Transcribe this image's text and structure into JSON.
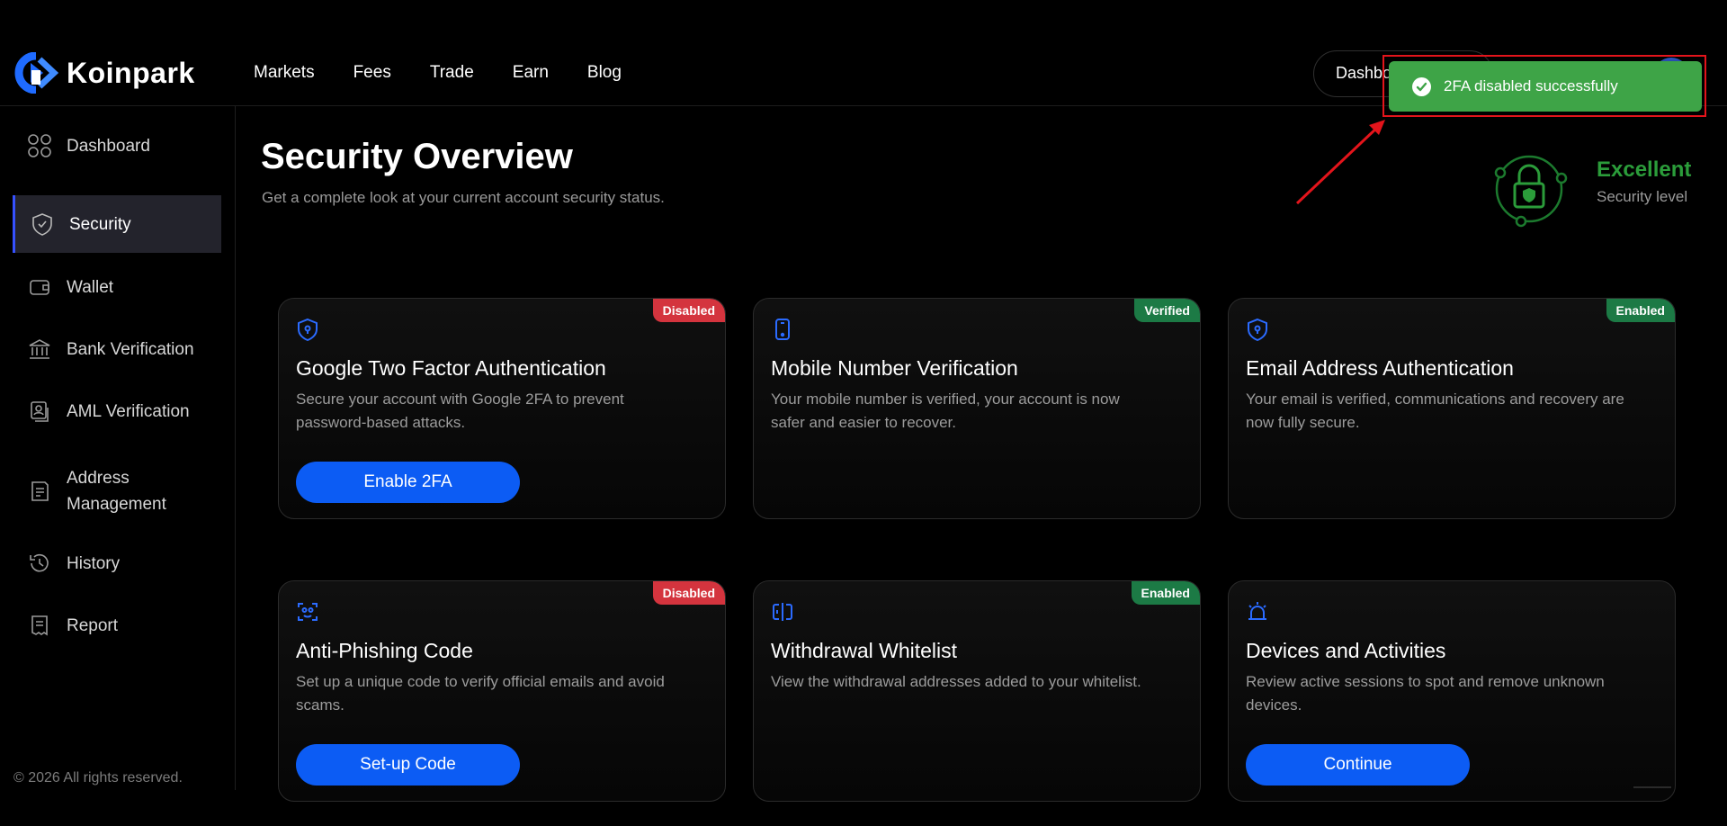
{
  "brand": {
    "name": "Koinpark",
    "accent": "#3651ff"
  },
  "nav": [
    {
      "label": "Markets"
    },
    {
      "label": "Fees"
    },
    {
      "label": "Trade"
    },
    {
      "label": "Earn"
    },
    {
      "label": "Blog"
    }
  ],
  "header_right": {
    "dashboard_label": "Dashbo"
  },
  "toast": {
    "message": "2FA disabled successfully",
    "color": "#3ea447",
    "icon": "check-circle-icon"
  },
  "sidebar": {
    "items": [
      {
        "label": "Dashboard",
        "icon": "grid-icon"
      },
      {
        "label": "Security",
        "icon": "shield-check-icon"
      },
      {
        "label": "Wallet",
        "icon": "wallet-icon"
      },
      {
        "label": "Bank Verification",
        "icon": "bank-icon"
      },
      {
        "label": "AML Verification",
        "icon": "id-card-icon"
      },
      {
        "label": "Address Management",
        "icon": "address-book-icon"
      },
      {
        "label": "History",
        "icon": "history-icon"
      },
      {
        "label": "Report",
        "icon": "report-icon"
      }
    ],
    "active": "Security",
    "copyright": "© 2026 All rights reserved."
  },
  "page": {
    "title": "Security Overview",
    "subtitle": "Get a complete look at your current account security status."
  },
  "security_level": {
    "value": "Excellent",
    "label": "Security level",
    "color": "#2b9c3a"
  },
  "cards": [
    {
      "title": "Google Two Factor Authentication",
      "description": "Secure your account with Google 2FA to prevent password-based attacks.",
      "status": "Disabled",
      "button": "Enable 2FA",
      "icon": "shield-lock-icon"
    },
    {
      "title": "Mobile Number Verification",
      "description": "Your mobile number is verified, your account is now safer and easier to recover.",
      "status": "Verified",
      "button": "",
      "icon": "mobile-phone-icon"
    },
    {
      "title": "Email Address Authentication",
      "description": "Your email is verified, communications and recovery are now fully secure.",
      "status": "Enabled",
      "button": "",
      "icon": "shield-lock-icon"
    },
    {
      "title": "Anti-Phishing Code",
      "description": "Set up a unique code to verify official emails and avoid scams.",
      "status": "Disabled",
      "button": "Set-up Code",
      "icon": "face-scan-icon"
    },
    {
      "title": "Withdrawal Whitelist",
      "description": "View the withdrawal addresses added to your whitelist.",
      "status": "Enabled",
      "button": "",
      "icon": "whitelist-icon"
    },
    {
      "title": "Devices and Activities",
      "description": "Review active sessions to spot and remove unknown devices.",
      "status": "",
      "button": "Continue",
      "icon": "alarm-icon"
    }
  ]
}
